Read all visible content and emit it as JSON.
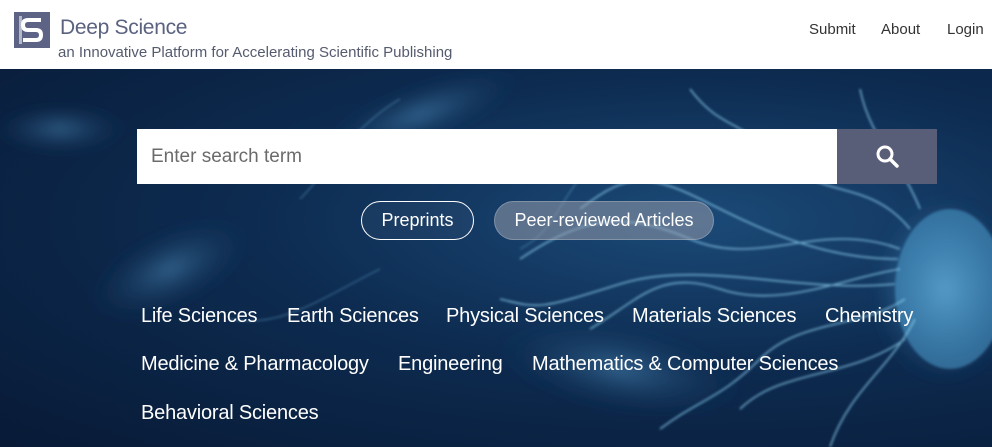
{
  "brand": {
    "name": "Deep Science",
    "tagline": "an Innovative Platform for Accelerating Scientific Publishing"
  },
  "nav": {
    "submit": "Submit",
    "about": "About",
    "login": "Login"
  },
  "search": {
    "placeholder": "Enter search term",
    "value": "",
    "icon": "search-icon"
  },
  "filters": {
    "preprints": "Preprints",
    "peer_reviewed": "Peer-reviewed Articles"
  },
  "categories": [
    "Life Sciences",
    "Earth Sciences",
    "Physical Sciences",
    "Materials Sciences",
    "Chemistry",
    "Medicine & Pharmacology",
    "Engineering",
    "Mathematics & Computer Sciences",
    "Behavioral Sciences"
  ],
  "colors": {
    "brand": "#5a6280",
    "search_button": "#585d78",
    "hero_bg": "#0d2b50"
  }
}
